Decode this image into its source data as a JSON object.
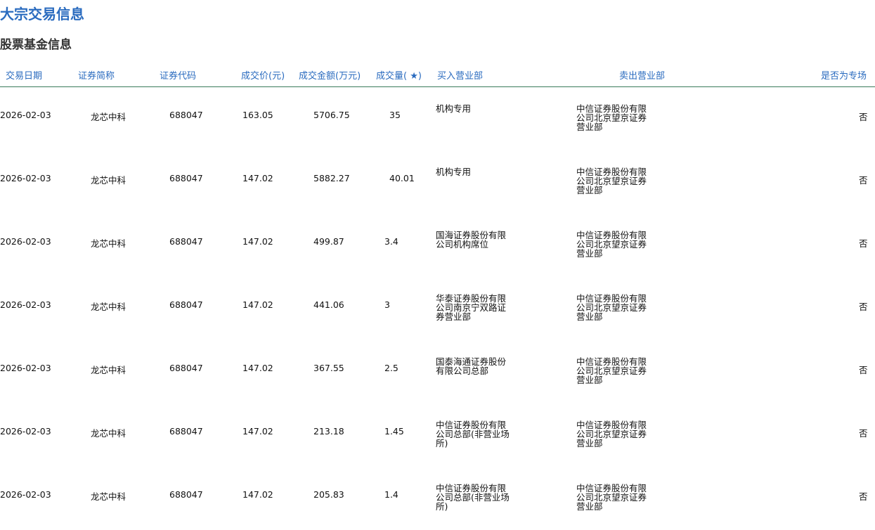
{
  "page": {
    "title": "大宗交易信息",
    "section_title": "股票基金信息"
  },
  "table": {
    "headers": [
      "交易日期",
      "证券简称",
      "证券代码",
      "成交价(元)",
      "成交金额(万元)",
      "成交量( ★)",
      "买入营业部",
      "卖出营业部",
      "是否为专场"
    ],
    "rows": [
      {
        "date": "2026-02-03",
        "name": "龙芯中科",
        "code": "688047",
        "price": "163.05",
        "amount": "5706.75",
        "volume": "35",
        "buyer": "机构专用",
        "seller": "中信证券股份有限公司北京望京证券营业部",
        "special": "否"
      },
      {
        "date": "2026-02-03",
        "name": "龙芯中科",
        "code": "688047",
        "price": "147.02",
        "amount": "5882.27",
        "volume": "40.01",
        "buyer": "机构专用",
        "seller": "中信证券股份有限公司北京望京证券营业部",
        "special": "否"
      },
      {
        "date": "2026-02-03",
        "name": "龙芯中科",
        "code": "688047",
        "price": "147.02",
        "amount": "499.87",
        "volume": "3.4",
        "buyer": "国海证券股份有限公司机构席位",
        "seller": "中信证券股份有限公司北京望京证券营业部",
        "special": "否"
      },
      {
        "date": "2026-02-03",
        "name": "龙芯中科",
        "code": "688047",
        "price": "147.02",
        "amount": "441.06",
        "volume": "3",
        "buyer": "华泰证券股份有限公司南京宁双路证券营业部",
        "seller": "中信证券股份有限公司北京望京证券营业部",
        "special": "否"
      },
      {
        "date": "2026-02-03",
        "name": "龙芯中科",
        "code": "688047",
        "price": "147.02",
        "amount": "367.55",
        "volume": "2.5",
        "buyer": "国泰海通证券股份有限公司总部",
        "seller": "中信证券股份有限公司北京望京证券营业部",
        "special": "否"
      },
      {
        "date": "2026-02-03",
        "name": "龙芯中科",
        "code": "688047",
        "price": "147.02",
        "amount": "213.18",
        "volume": "1.45",
        "buyer": "中信证券股份有限公司总部(非营业场所)",
        "seller": "中信证券股份有限公司北京望京证券营业部",
        "special": "否"
      },
      {
        "date": "2026-02-03",
        "name": "龙芯中科",
        "code": "688047",
        "price": "147.02",
        "amount": "205.83",
        "volume": "1.4",
        "buyer": "中信证券股份有限公司总部(非营业场所)",
        "seller": "中信证券股份有限公司北京望京证券营业部",
        "special": "否"
      }
    ]
  },
  "colors": {
    "accent": "#2a6bbf",
    "header_rule": "#3a7a5a"
  }
}
